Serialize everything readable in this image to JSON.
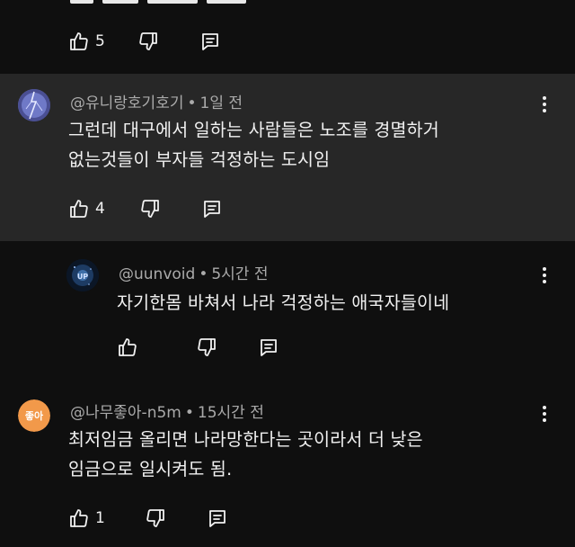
{
  "comments": [
    {
      "id": "top-partial",
      "author": "",
      "time": "",
      "text": "",
      "likes": "5"
    },
    {
      "id": "c1",
      "author": "@유니랑호기호기",
      "time": "1일 전",
      "text": "그런데 대구에서 일하는 사람들은 노조를 경멸하거\n없는것들이 부자들 걱정하는 도시임",
      "likes": "4",
      "avatar_icon": "lightning-avatar-icon"
    },
    {
      "id": "c2",
      "author": "@uunvoid",
      "time": "5시간 전",
      "text": "자기한몸 바쳐서 나라 걱정하는 애국자들이네",
      "likes": "",
      "avatar_icon": "galaxy-avatar-icon",
      "avatar_label": "UP"
    },
    {
      "id": "c3",
      "author": "@나무좋아-n5m",
      "time": "15시간 전",
      "text": "최저임금 올리면 나라망한다는 곳이라서 더 낮은\n임금으로 일시켜도 됨.",
      "likes": "1",
      "avatar_label": "좋아",
      "avatar_color": "#f2994a"
    }
  ],
  "meta_separator": "•"
}
